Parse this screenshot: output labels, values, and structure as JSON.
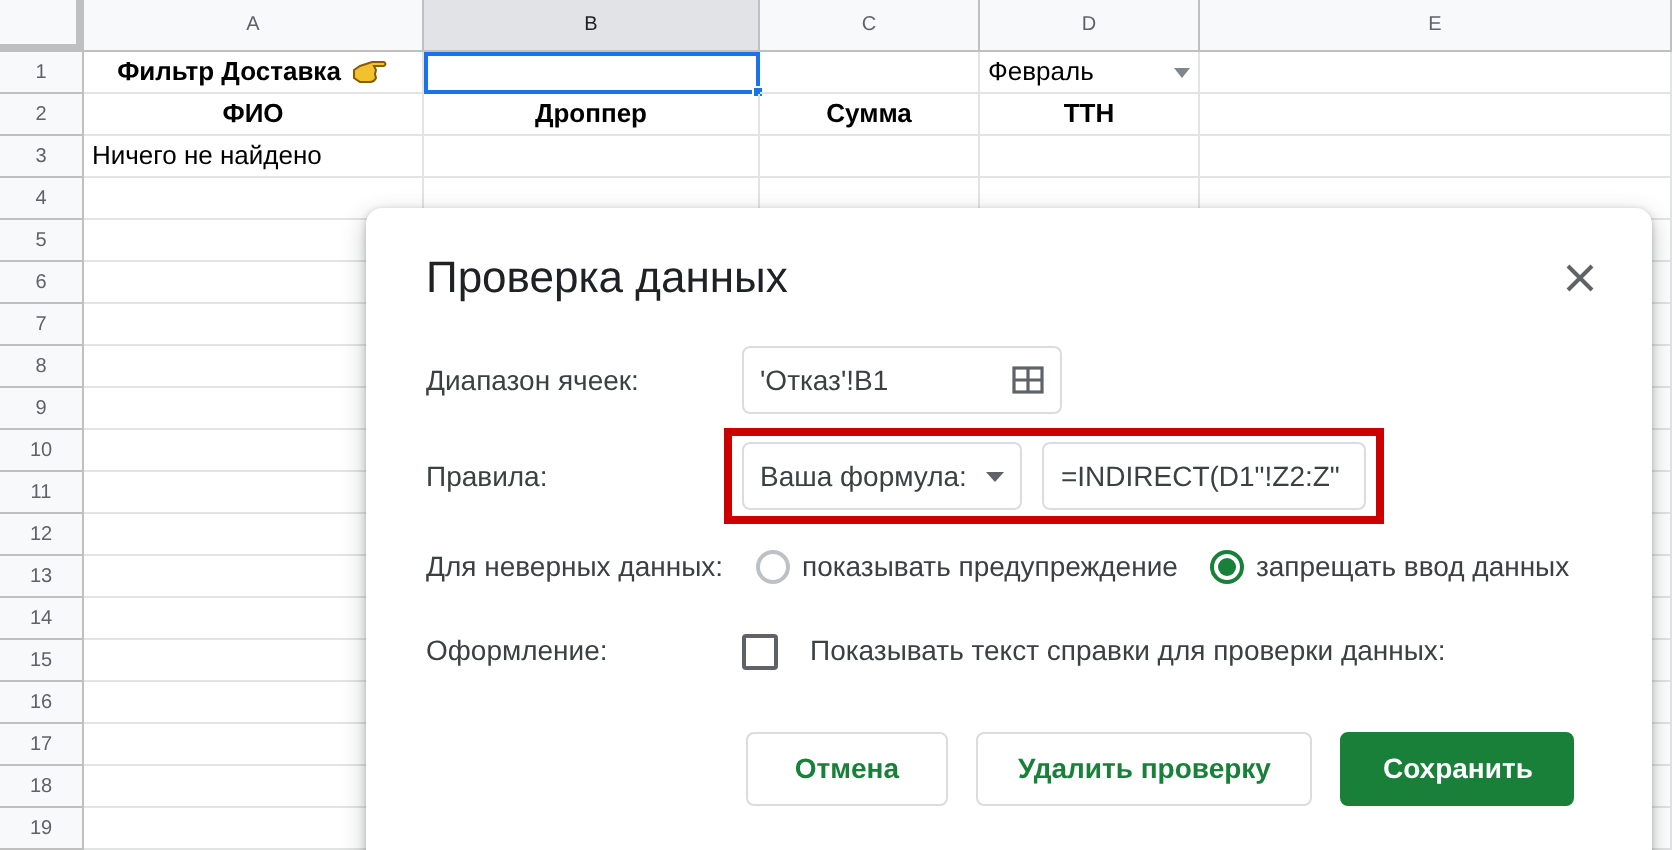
{
  "sheet": {
    "columns": [
      {
        "label": "A",
        "selected": false
      },
      {
        "label": "B",
        "selected": true
      },
      {
        "label": "C",
        "selected": false
      },
      {
        "label": "D",
        "selected": false
      },
      {
        "label": "E",
        "selected": false
      }
    ],
    "rows": [
      {
        "number": "1",
        "cells": [
          {
            "kind": "hand-note",
            "text": "Фильтр Доставка",
            "bold": true,
            "selected": false
          },
          {
            "kind": "text",
            "selected": true
          },
          {
            "kind": "text",
            "selected": false
          },
          {
            "kind": "dropdown",
            "text": "Февраль",
            "bold": false,
            "selected": false
          },
          {
            "kind": "text",
            "selected": false
          }
        ]
      },
      {
        "number": "2",
        "cells": [
          {
            "kind": "text",
            "text": "ФИО",
            "bold": true,
            "selected": false
          },
          {
            "kind": "text",
            "text": "Дроппер",
            "bold": true,
            "selected": false
          },
          {
            "kind": "text",
            "text": "Сумма",
            "bold": true,
            "selected": false
          },
          {
            "kind": "text",
            "text": "ТТН",
            "bold": true,
            "selected": false
          },
          {
            "kind": "text",
            "selected": false
          }
        ]
      },
      {
        "number": "3",
        "cells": [
          {
            "kind": "text",
            "text": "Ничего не найдено",
            "bold": false,
            "selected": false
          },
          {
            "kind": "text",
            "selected": false
          },
          {
            "kind": "text",
            "selected": false
          },
          {
            "kind": "text",
            "selected": false
          },
          {
            "kind": "text",
            "selected": false
          }
        ]
      },
      {
        "number": "4"
      },
      {
        "number": "5"
      },
      {
        "number": "6"
      },
      {
        "number": "7"
      },
      {
        "number": "8"
      },
      {
        "number": "9"
      },
      {
        "number": "10"
      },
      {
        "number": "11"
      },
      {
        "number": "12"
      },
      {
        "number": "13"
      },
      {
        "number": "14"
      },
      {
        "number": "15"
      },
      {
        "number": "16"
      },
      {
        "number": "17"
      },
      {
        "number": "18"
      },
      {
        "number": "19"
      }
    ]
  },
  "dialog": {
    "title": "Проверка данных",
    "range": {
      "label": "Диапазон ячеек:",
      "value": "'Отказ'!B1"
    },
    "rules": {
      "label": "Правила:",
      "criterion": "Ваша формула:",
      "formula": "=INDIRECT(D1\"!Z2:Z\"",
      "highlighted": true
    },
    "invalid_data": {
      "label": "Для неверных данных:",
      "options": [
        {
          "label": "показывать предупреждение",
          "selected": false
        },
        {
          "label": "запрещать ввод данных",
          "selected": true
        }
      ]
    },
    "appearance": {
      "label": "Оформление:",
      "checkbox": {
        "label": "Показывать текст справки для проверки данных:",
        "checked": false
      }
    },
    "buttons": [
      {
        "label": "Отмена",
        "kind": "secondary"
      },
      {
        "label": "Удалить проверку",
        "kind": "secondary"
      },
      {
        "label": "Сохранить",
        "kind": "primary"
      }
    ]
  }
}
